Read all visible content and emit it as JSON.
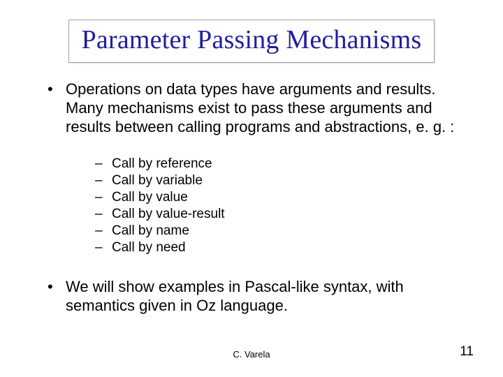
{
  "title": "Parameter Passing Mechanisms",
  "bullet1": "Operations on data types have arguments and results. Many mechanisms exist to pass these arguments and results between calling programs and abstractions, e. g. :",
  "subitems": {
    "s0": "Call by reference",
    "s1": "Call by variable",
    "s2": "Call by value",
    "s3": "Call by value-result",
    "s4": "Call by name",
    "s5": "Call by need"
  },
  "bullet2": "We will show examples in Pascal-like syntax, with semantics given in Oz language.",
  "footer": {
    "author": "C. Varela",
    "page": "11"
  }
}
